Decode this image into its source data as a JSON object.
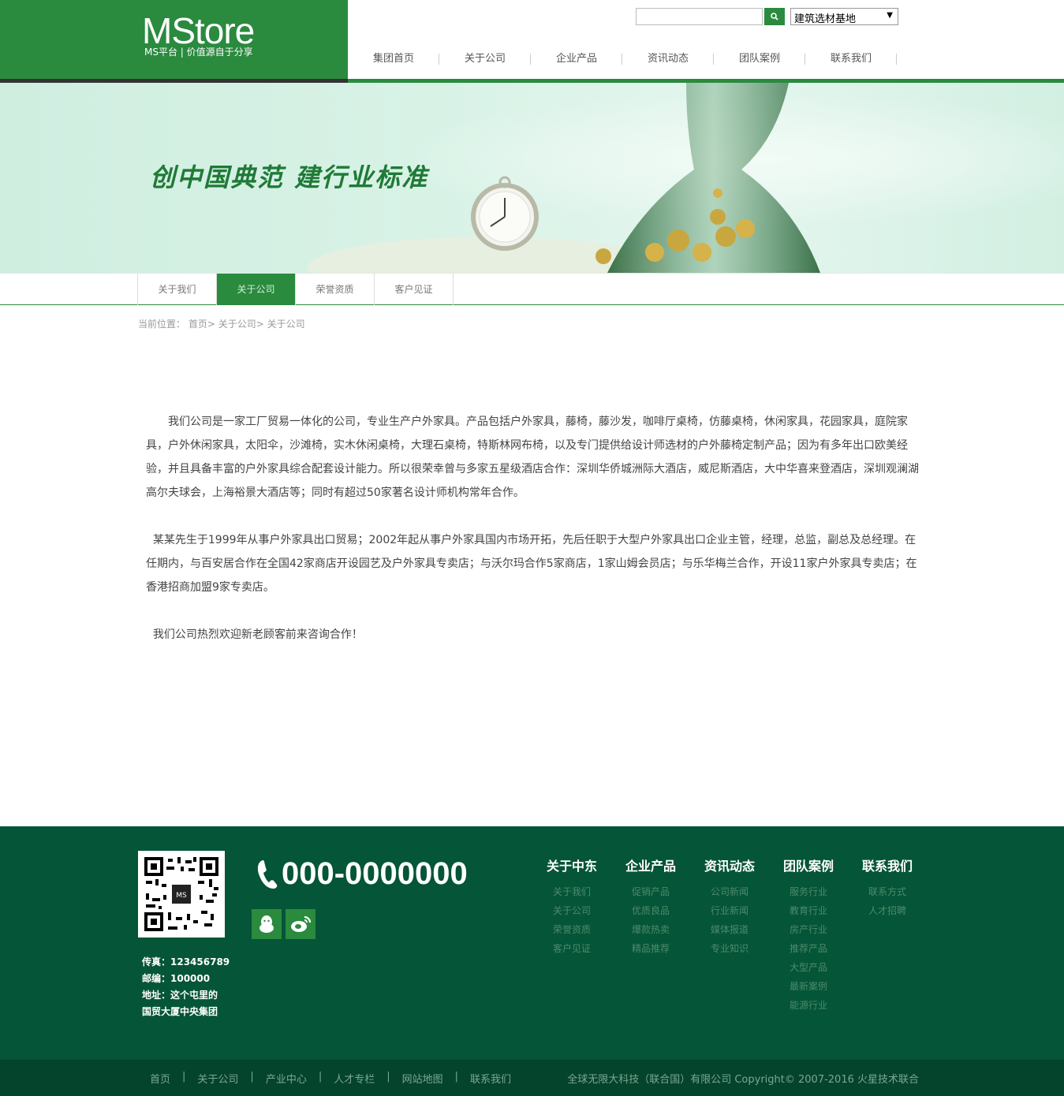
{
  "header": {
    "logo_title": "MStore",
    "logo_sub": "MS平台 | 价值源自于分享",
    "search_placeholder": "",
    "select_value": "建筑选材基地",
    "nav": [
      "集团首页",
      "关于公司",
      "企业产品",
      "资讯动态",
      "团队案例",
      "联系我们"
    ]
  },
  "banner": {
    "slogan": "创中国典范  建行业标准"
  },
  "subnav": {
    "items": [
      "关于我们",
      "关于公司",
      "荣誉资质",
      "客户见证"
    ],
    "active_index": 1
  },
  "breadcrumb": {
    "label": "当前位置：",
    "path": "首页> 关于公司> 关于公司"
  },
  "content": {
    "paragraphs": [
      "　　我们公司是一家工厂贸易一体化的公司，专业生产户外家具。产品包括户外家具，藤椅，藤沙发，咖啡厅桌椅，仿藤桌椅，休闲家具，花园家具，庭院家具，户外休闲家具，太阳伞，沙滩椅，实木休闲桌椅，大理石桌椅，特斯林网布椅，以及专门提供给设计师选材的户外藤椅定制产品；因为有多年出口欧美经验，并且具备丰富的户外家具综合配套设计能力。所以很荣幸曾与多家五星级酒店合作：深圳华侨城洲际大酒店，威尼斯酒店，大中华喜来登酒店，深圳观澜湖高尔夫球会，上海裕景大酒店等；同时有超过50家著名设计师机构常年合作。",
      "  某某先生于1999年从事户外家具出口贸易；2002年起从事户外家具国内市场开拓，先后任职于大型户外家具出口企业主管，经理，总监，副总及总经理。在任期内，与百安居合作在全国42家商店开设园艺及户外家具专卖店；与沃尔玛合作5家商店，1家山姆会员店；与乐华梅兰合作，开设11家户外家具专卖店；在香港招商加盟9家专卖店。",
      "  我们公司热烈欢迎新老顾客前来咨询合作！"
    ]
  },
  "footer": {
    "qr_label": "MS",
    "contact": {
      "fax": "传真：123456789",
      "postcode": "邮编：100000",
      "address1": "地址：这个屯里的",
      "address2": "国贸大厦中央集团"
    },
    "phone": "000-0000000",
    "columns": [
      {
        "title": "关于中东",
        "links": [
          "关于我们",
          "关于公司",
          "荣誉资质",
          "客户见证"
        ]
      },
      {
        "title": "企业产品",
        "links": [
          "促销产品",
          "优质良品",
          "爆款热卖",
          "精品推荐"
        ]
      },
      {
        "title": "资讯动态",
        "links": [
          "公司新闻",
          "行业新闻",
          "媒体报道",
          "专业知识"
        ]
      },
      {
        "title": "团队案例",
        "links": [
          "服务行业",
          "教育行业",
          "房产行业",
          "推荐产品",
          "大型产品",
          "最新案例",
          "能源行业"
        ]
      },
      {
        "title": "联系我们",
        "links": [
          "联系方式",
          "人才招聘"
        ]
      }
    ]
  },
  "bottom": {
    "links": [
      "首页",
      "关于公司",
      "产业中心",
      "人才专栏",
      "网站地图",
      "联系我们"
    ],
    "copyright": "全球无限大科技（联合国）有限公司 Copyright© 2007-2016 火星技术联合"
  },
  "colors": {
    "brand_green": "#2a8a3e",
    "footer_green": "#055538",
    "bottom_green": "#04432c"
  }
}
